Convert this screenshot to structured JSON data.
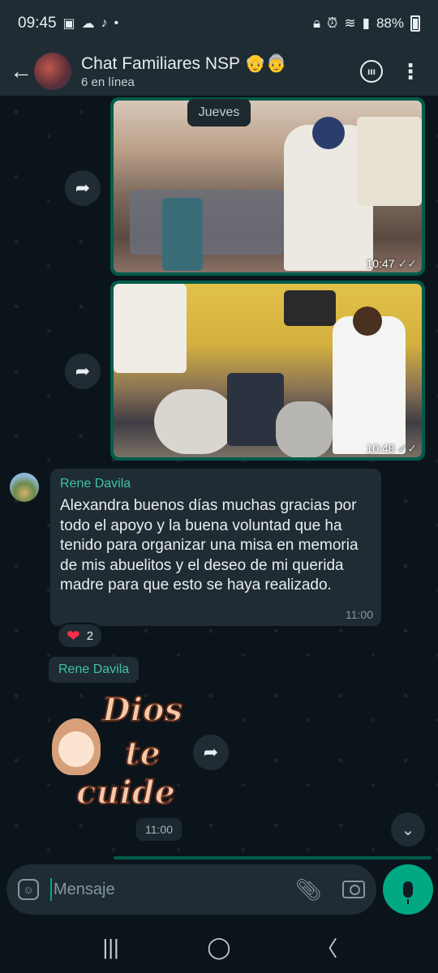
{
  "status_bar": {
    "time": "09:45",
    "battery": "88%",
    "icons_left": [
      "image-icon",
      "cloud-icon",
      "tiktok-icon",
      "dot-icon"
    ],
    "icons_right": [
      "lock-icon",
      "alarm-icon",
      "wifi-icon",
      "signal-icon",
      "battery-icon"
    ]
  },
  "header": {
    "title": "Chat Familiares NSP 👴👵",
    "subtitle": "6 en línea"
  },
  "chat": {
    "date_label": "Jueves",
    "images": [
      {
        "time": "10:47",
        "ticks": "✓✓"
      },
      {
        "time": "10:48",
        "ticks": "✓✓"
      }
    ],
    "text_message": {
      "sender": "Rene Davila",
      "text": "Alexandra buenos días muchas gracias por todo el apoyo y la buena voluntad que ha tenido para organizar una misa en memoria de mis abuelitos y el deseo de mi querida madre para que esto se haya realizado.",
      "time": "11:00",
      "reaction_emoji": "❤",
      "reaction_count": "2"
    },
    "sticker_message": {
      "sender": "Rene Davila",
      "sticker_words": [
        "Dios",
        "te",
        "cuide"
      ],
      "time": "11:00"
    }
  },
  "composer": {
    "placeholder": "Mensaje"
  },
  "colors": {
    "accent": "#00a884",
    "outgoing_bubble": "#005c4b",
    "incoming_bubble": "#1f2c34",
    "background": "#0b141a"
  }
}
